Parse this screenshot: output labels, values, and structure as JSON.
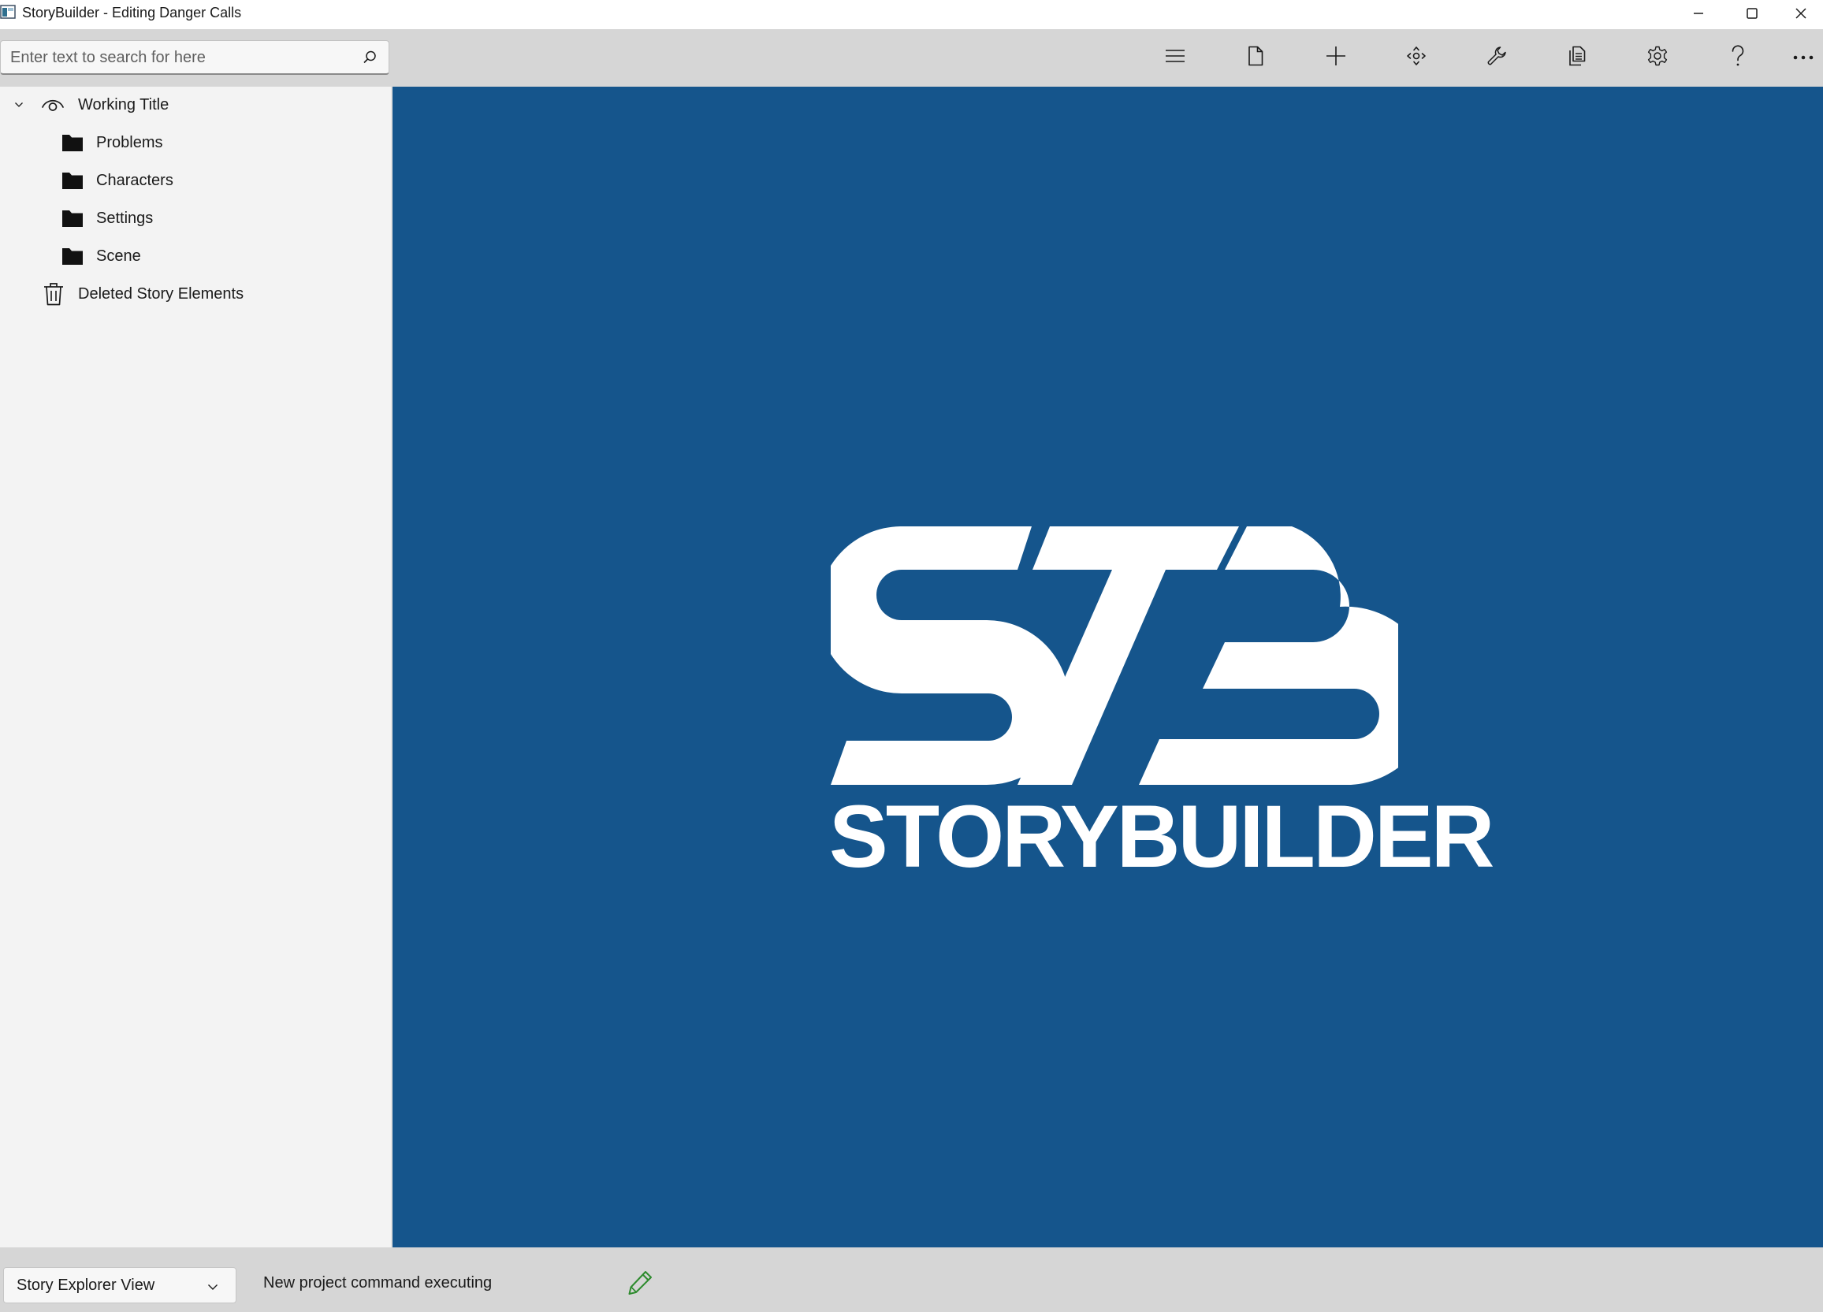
{
  "window": {
    "title": "StoryBuilder - Editing Danger Calls",
    "controls": [
      "minimize-icon",
      "maximize-icon",
      "close-icon"
    ]
  },
  "toolbar": {
    "search_placeholder": "Enter text to search for here",
    "search_value": "",
    "buttons": [
      {
        "name": "menu",
        "icon": "hamburger-icon"
      },
      {
        "name": "file",
        "icon": "document-icon"
      },
      {
        "name": "add",
        "icon": "plus-icon"
      },
      {
        "name": "move",
        "icon": "move-icon"
      },
      {
        "name": "tools",
        "icon": "wrench-icon"
      },
      {
        "name": "reports",
        "icon": "copy-icon"
      },
      {
        "name": "settings",
        "icon": "gear-icon"
      },
      {
        "name": "help",
        "icon": "help-icon"
      },
      {
        "name": "more",
        "icon": "more-icon"
      }
    ]
  },
  "explorer": {
    "root": {
      "label": "Working Title",
      "icon": "eye-icon",
      "expanded": true
    },
    "children": [
      {
        "label": "Problems",
        "icon": "folder-icon"
      },
      {
        "label": "Characters",
        "icon": "folder-icon"
      },
      {
        "label": "Settings",
        "icon": "folder-icon"
      },
      {
        "label": "Scene",
        "icon": "folder-icon"
      }
    ],
    "trash": {
      "label": "Deleted Story Elements",
      "icon": "trash-icon"
    }
  },
  "main": {
    "background_color": "#15558c",
    "logo_monogram": "STB",
    "logo_text": "STORYBUILDER"
  },
  "statusbar": {
    "view_selected": "Story Explorer View",
    "message": "New project command executing",
    "status_icon": "pencil-icon",
    "status_icon_color": "#2e8b2e"
  }
}
